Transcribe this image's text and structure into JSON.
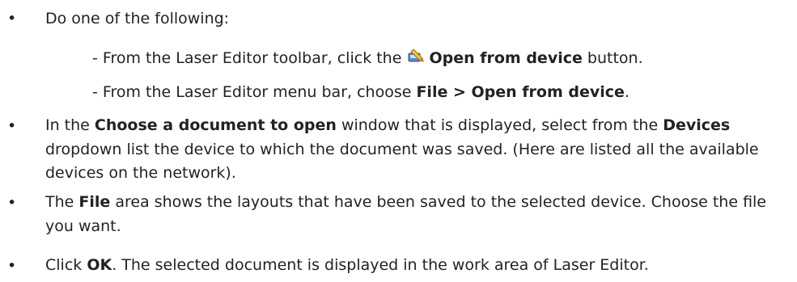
{
  "steps": [
    {
      "text": "Do one of the following:"
    },
    {
      "sub": [
        {
          "pre": "- From the Laser Editor toolbar, click the ",
          "icon": "open-from-device-icon",
          "bold": "Open from device",
          "post": " button."
        },
        {
          "pre": "- From the Laser Editor menu bar, choose ",
          "bold": "File > Open from device",
          "post": "."
        }
      ]
    },
    {
      "pre": "In the ",
      "bold1": "Choose a document to open",
      "mid": " window that is displayed, select from the ",
      "bold2": "Devices",
      "post": " dropdown list the device to which the document was saved. (Here are listed all the available devices on the network)."
    },
    {
      "pre": "The ",
      "bold": "File",
      "post": " area shows the layouts that have been saved to the selected device. Choose the file you want."
    },
    {
      "pre": "Click ",
      "bold": "OK",
      "post": ". The selected document is displayed in the work area of Laser Editor."
    }
  ],
  "bullet_char": "•"
}
